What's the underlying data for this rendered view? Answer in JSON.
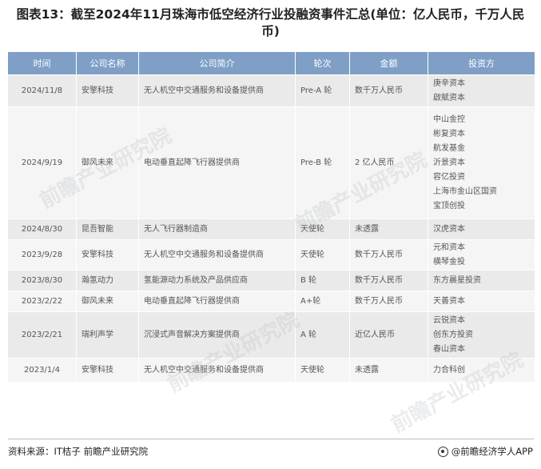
{
  "title": "图表13：截至2024年11月珠海市低空经济行业投融资事件汇总(单位：亿人民币，千万人民币)",
  "table": {
    "headers": [
      "时间",
      "公司名称",
      "公司简介",
      "轮次",
      "金额",
      "投资方"
    ],
    "rows": [
      {
        "date": "2024/11/8",
        "company": "安擎科技",
        "intro": "无人机空中交通服务和设备提供商",
        "round": "Pre-A 轮",
        "amount": "数千万人民币",
        "investors": [
          "庚辛资本",
          "啟赋资本"
        ]
      },
      {
        "date": "2024/9/19",
        "company": "御风未来",
        "intro": "电动垂直起降飞行器提供商",
        "round": "Pre-B 轮",
        "amount": "2 亿人民币",
        "investors": [
          "中山金控",
          "彬复资本",
          "航发基金",
          "沂景资本",
          "容亿投资",
          "上海市金山区国资",
          "宝顶创投"
        ]
      },
      {
        "date": "2024/8/30",
        "company": "昆吾智能",
        "intro": "无人飞行器制造商",
        "round": "天使轮",
        "amount": "未透露",
        "investors": [
          "汉虎资本"
        ]
      },
      {
        "date": "2023/9/28",
        "company": "安擎科技",
        "intro": "无人机空中交通服务和设备提供商",
        "round": "天使轮",
        "amount": "数千万人民币",
        "investors": [
          "元和资本",
          "横琴金投"
        ]
      },
      {
        "date": "2023/8/30",
        "company": "瀚氢动力",
        "intro": "氢能源动力系统及产品供应商",
        "round": "B 轮",
        "amount": "数千万人民币",
        "investors": [
          "东方晨星投资"
        ]
      },
      {
        "date": "2023/2/22",
        "company": "御风未来",
        "intro": "电动垂直起降飞行器提供商",
        "round": "A+轮",
        "amount": "数千万人民币",
        "investors": [
          "天善资本"
        ]
      },
      {
        "date": "2023/2/21",
        "company": "瑞利声学",
        "intro": "沉浸式声音解决方案提供商",
        "round": "A 轮",
        "amount": "近亿人民币",
        "investors": [
          "云锐资本",
          "创东方投资",
          "春山资本"
        ]
      },
      {
        "date": "2023/1/4",
        "company": "安擎科技",
        "intro": "无人机空中交通服务和设备提供商",
        "round": "天使轮",
        "amount": "未透露",
        "investors": [
          "力合科创"
        ]
      }
    ]
  },
  "footer": {
    "source": "资料来源：IT桔子 前瞻产业研究院",
    "brand": "@前瞻经济学人APP"
  },
  "watermark": "前瞻产业研究院",
  "colors": {
    "header_bg": "#7f9fc6",
    "row_odd": "#eaeaea",
    "row_even": "#f5f5f5"
  }
}
